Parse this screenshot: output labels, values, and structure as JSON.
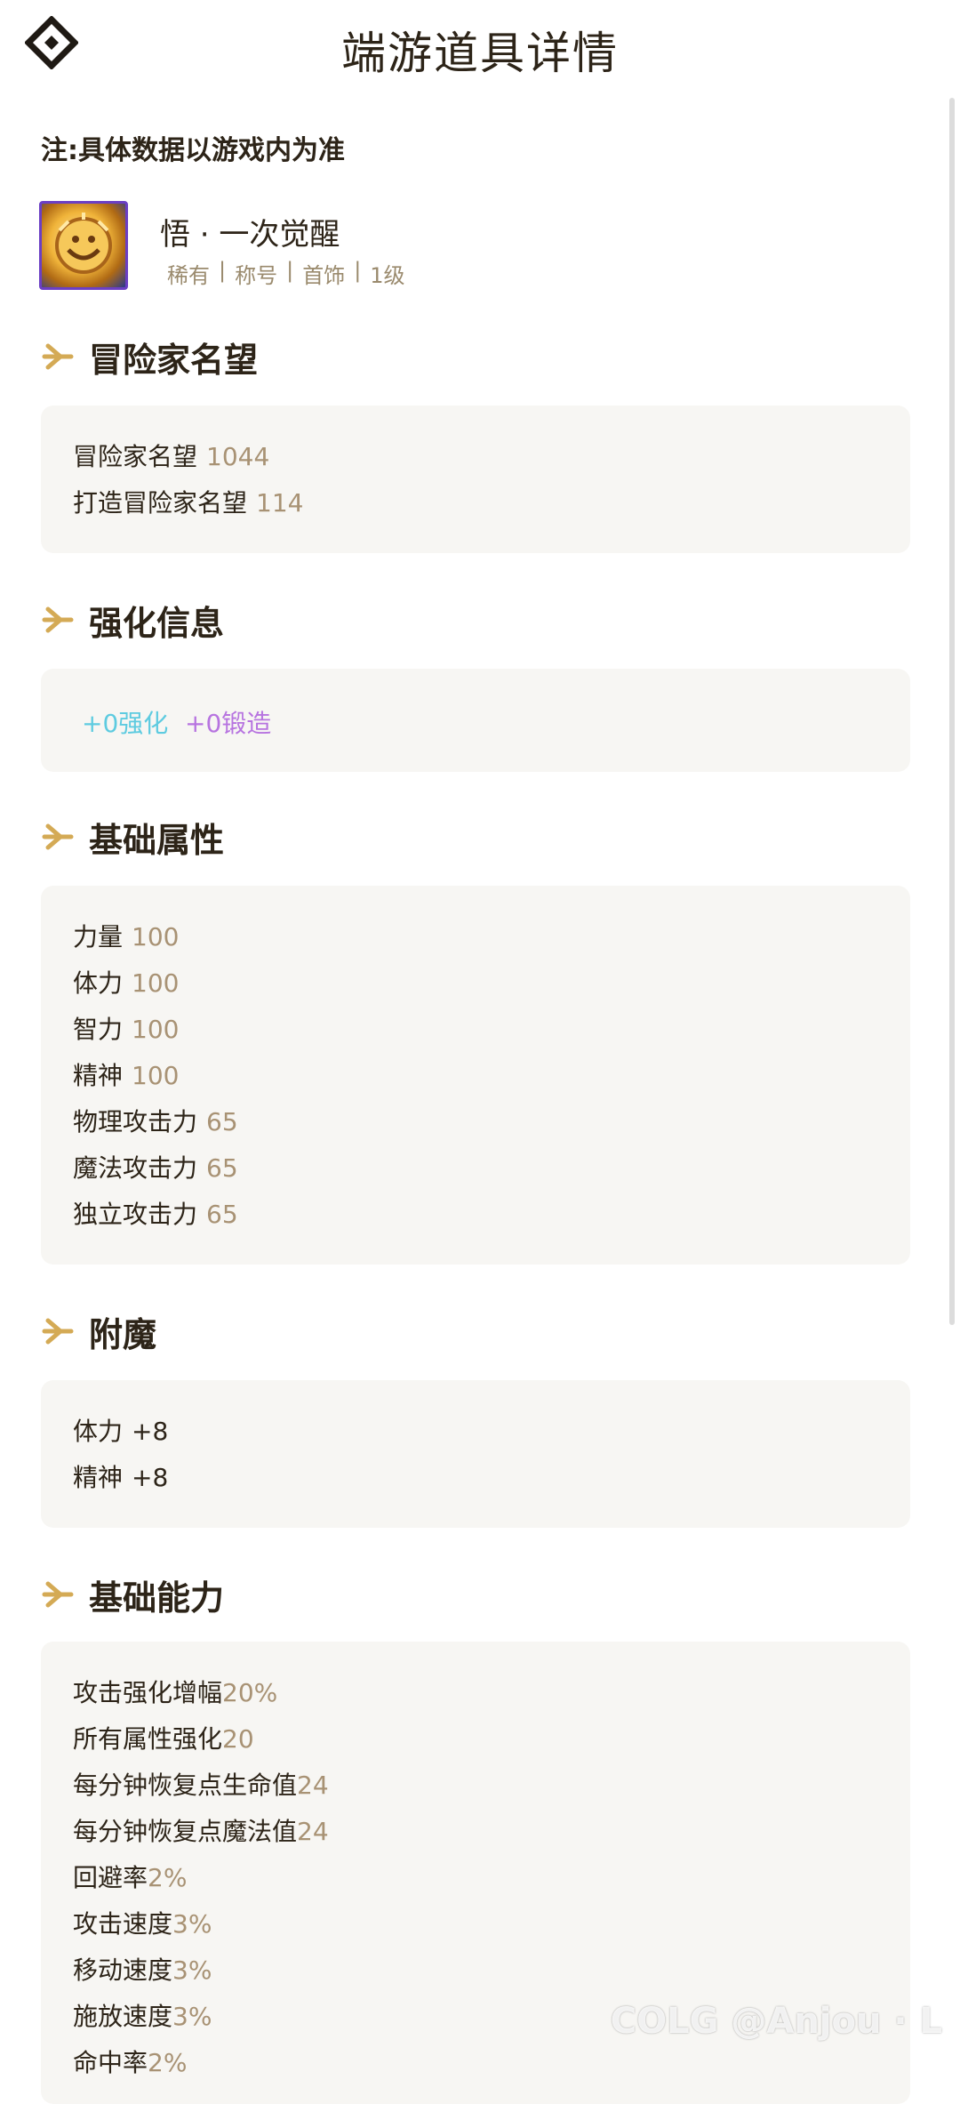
{
  "header": {
    "title": "端游道具详情"
  },
  "note": "注:具体数据以游戏内为准",
  "item": {
    "name": "悟 · 一次觉醒",
    "tags": [
      "稀有",
      "称号",
      "首饰",
      "1级"
    ]
  },
  "sections": {
    "renown": {
      "title": "冒险家名望",
      "rows": [
        {
          "label": "冒险家名望",
          "value": "1044"
        },
        {
          "label": "打造冒险家名望",
          "value": "114"
        }
      ]
    },
    "enhance": {
      "title": "强化信息",
      "reinforce": "+0强化",
      "forge": "+0锻造",
      "reinforce_color": "#5ecbe0",
      "forge_color": "#b774e0"
    },
    "base_attrs": {
      "title": "基础属性",
      "rows": [
        {
          "label": "力量",
          "value": "100"
        },
        {
          "label": "体力",
          "value": "100"
        },
        {
          "label": "智力",
          "value": "100"
        },
        {
          "label": "精神",
          "value": "100"
        },
        {
          "label": "物理攻击力",
          "value": "65"
        },
        {
          "label": "魔法攻击力",
          "value": "65"
        },
        {
          "label": "独立攻击力",
          "value": "65"
        }
      ]
    },
    "enchant": {
      "title": "附魔",
      "rows": [
        {
          "label": "体力",
          "value": "+8"
        },
        {
          "label": "精神",
          "value": "+8"
        }
      ]
    },
    "abilities": {
      "title": "基础能力",
      "rows": [
        {
          "label": "攻击强化增幅",
          "value": "20%"
        },
        {
          "label": "所有属性强化",
          "value": "20"
        },
        {
          "label": "每分钟恢复点生命值",
          "value": "24"
        },
        {
          "label": "每分钟恢复点魔法值",
          "value": "24"
        },
        {
          "label": "回避率",
          "value": "2%"
        },
        {
          "label": "攻击速度",
          "value": "3%"
        },
        {
          "label": "移动速度",
          "value": "3%"
        },
        {
          "label": "施放速度",
          "value": "3%"
        },
        {
          "label": "命中率",
          "value": "2%"
        }
      ]
    }
  },
  "watermark": "COLG @Anjou · L",
  "colors": {
    "accent": "#d4aa55",
    "value": "#a89274",
    "card_bg": "#f7f6f3",
    "text": "#2d2418"
  }
}
